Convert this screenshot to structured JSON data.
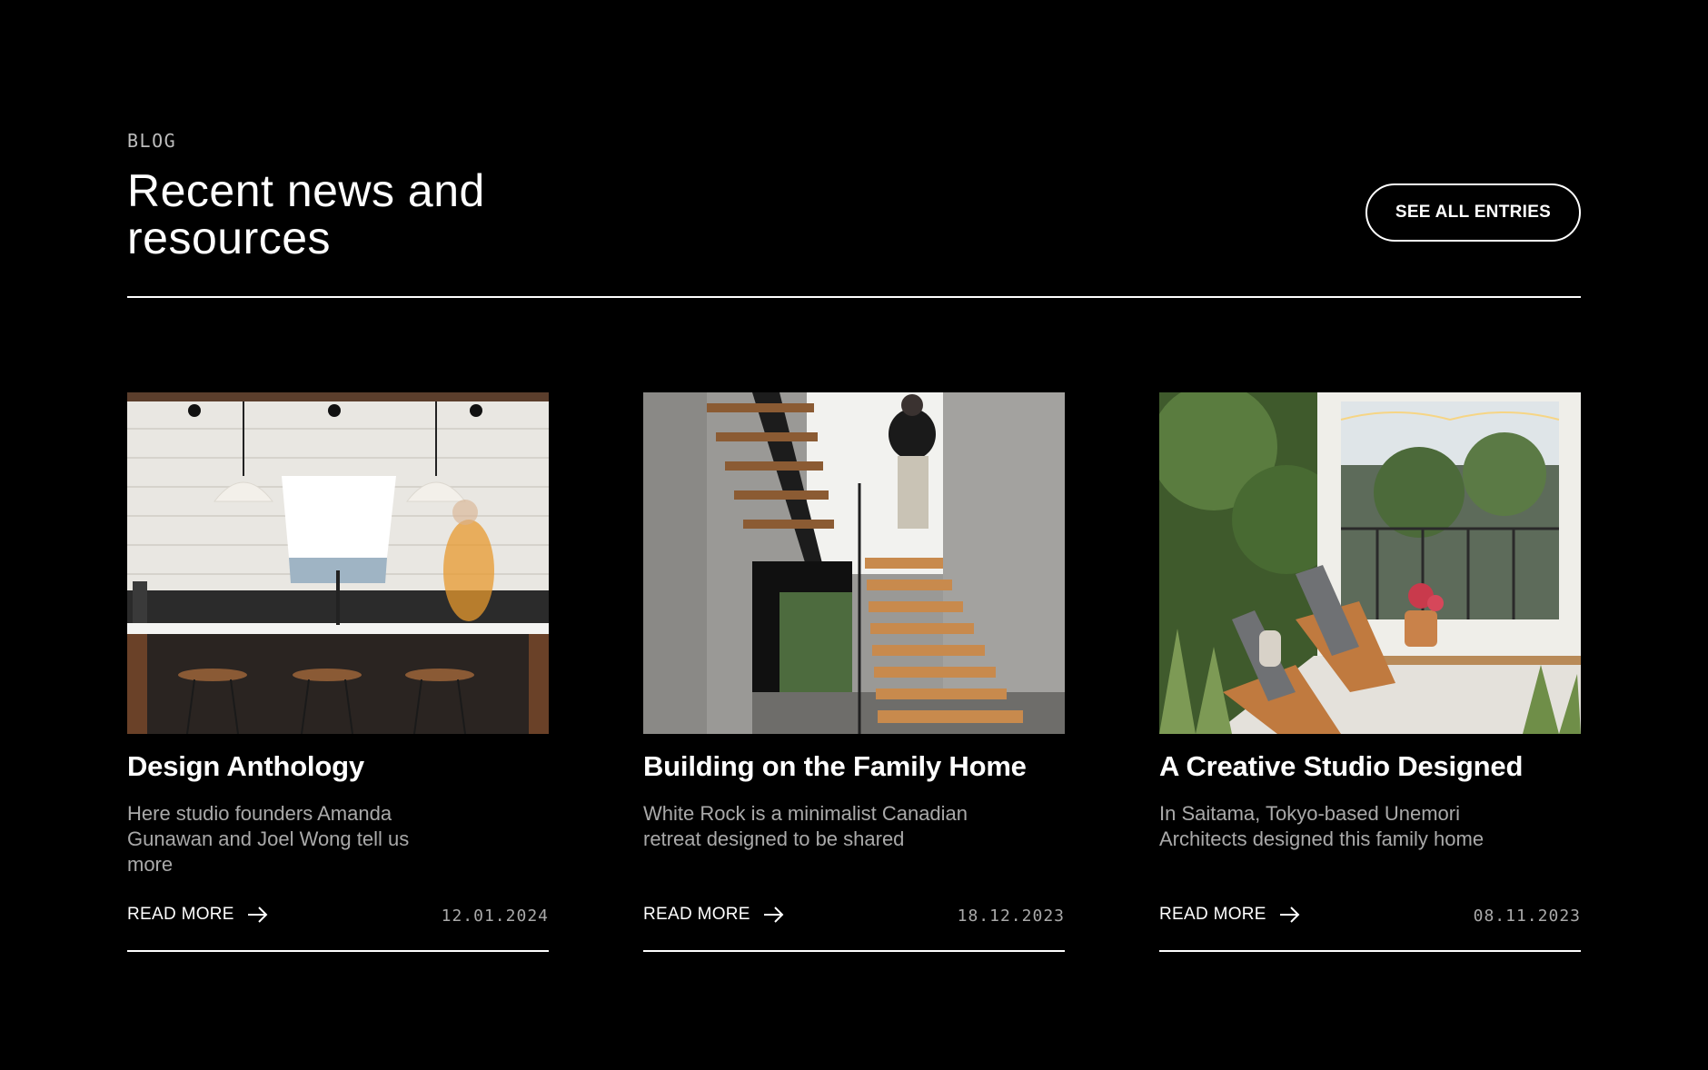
{
  "section": {
    "eyebrow": "BLOG",
    "title": "Recent news and resources",
    "see_all_label": "SEE ALL ENTRIES"
  },
  "posts": [
    {
      "title": "Design Anthology",
      "excerpt": "Here studio founders Amanda Gunawan and Joel Wong tell us more",
      "read_more": "READ MORE",
      "date": "12.01.2024",
      "image": "kitchen-island-pendant-lights-photo"
    },
    {
      "title": "Building on the Family Home",
      "excerpt": "White Rock is a minimalist Canadian retreat designed to be shared",
      "read_more": "READ MORE",
      "date": "18.12.2023",
      "image": "floating-wooden-staircase-photo"
    },
    {
      "title": "A Creative Studio Designed",
      "excerpt": "In Saitama, Tokyo-based Unemori Architects designed this family home",
      "read_more": "READ MORE",
      "date": "08.11.2023",
      "image": "screened-porch-lounge-chairs-photo"
    }
  ],
  "colors": {
    "background": "#000000",
    "text": "#ffffff",
    "muted": "#a9a9a9"
  },
  "icons": {
    "read_more": "arrow-right-icon"
  }
}
